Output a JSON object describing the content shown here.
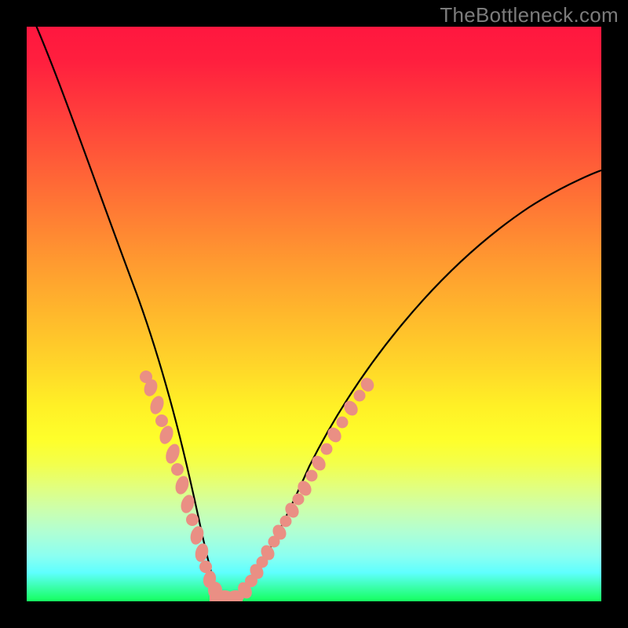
{
  "watermark": "TheBottleneck.com",
  "chart_data": {
    "type": "line",
    "title": "",
    "xlabel": "",
    "ylabel": "",
    "xlim": [
      0,
      100
    ],
    "ylim": [
      0,
      100
    ],
    "grid": false,
    "legend": false,
    "background_gradient": {
      "direction": "vertical-top-to-bottom",
      "stops": [
        {
          "pos": 0,
          "color": "#ff173f"
        },
        {
          "pos": 50,
          "color": "#ffb82c"
        },
        {
          "pos": 72,
          "color": "#feff2b"
        },
        {
          "pos": 100,
          "color": "#15ff5f"
        }
      ]
    },
    "series": [
      {
        "name": "bottleneck-curve",
        "color": "#000000",
        "x": [
          0,
          4,
          8,
          12,
          16,
          20,
          24,
          26,
          28,
          30,
          31,
          32,
          33,
          34,
          36,
          38,
          41,
          46,
          52,
          58,
          66,
          74,
          82,
          90,
          100
        ],
        "y": [
          104,
          89,
          75,
          62,
          50,
          39,
          28,
          22,
          15,
          8,
          5,
          2,
          0,
          0,
          0,
          2,
          6,
          12,
          20,
          28,
          38,
          48,
          57,
          65,
          75
        ]
      },
      {
        "name": "highlight-band-left",
        "color": "#ea8f84",
        "style": "dotted-thick",
        "x": [
          20,
          22,
          23.5,
          25,
          26.5,
          28,
          29.5,
          31
        ],
        "y": [
          39,
          33,
          29,
          24,
          19,
          15,
          10,
          5
        ]
      },
      {
        "name": "highlight-band-right",
        "color": "#ea8f84",
        "style": "dotted-thick",
        "x": [
          36,
          37.5,
          39,
          40.5,
          42,
          44,
          46,
          48
        ],
        "y": [
          0,
          2,
          4,
          6,
          8,
          10.5,
          12.5,
          15
        ]
      },
      {
        "name": "valley-fill",
        "color": "#ea8f84",
        "style": "solid-thick",
        "x": [
          31,
          32,
          33,
          34,
          35,
          36
        ],
        "y": [
          5,
          2,
          0,
          0,
          0,
          0
        ]
      }
    ]
  }
}
